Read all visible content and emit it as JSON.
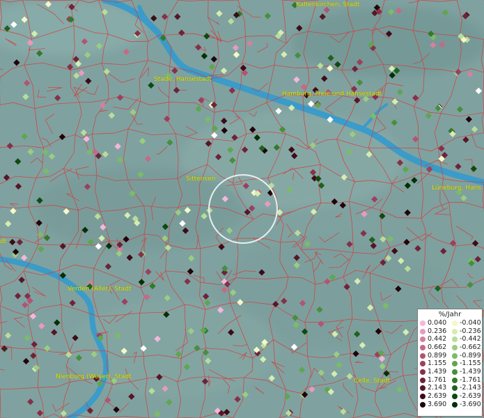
{
  "map": {
    "cities": [
      {
        "id": "kaltenkirchen",
        "label": "Kaltenkirchen, Stadt"
      },
      {
        "id": "stade",
        "label": "Stade, Hansestadt"
      },
      {
        "id": "hamburg",
        "label": "Hamburg, Freie und Hansestadt"
      },
      {
        "id": "sittensen",
        "label": "Sittensen"
      },
      {
        "id": "lueneburg",
        "label": "Lüneburg, Hans"
      },
      {
        "id": "verden",
        "label": "Verden (Aller), Stadt"
      },
      {
        "id": "nienburg",
        "label": "Nienburg (Weser), Stadt"
      },
      {
        "id": "celle",
        "label": "Celle, Stadt"
      },
      {
        "id": "edge-left",
        "label": "dt"
      }
    ],
    "colors": {
      "background": "#7fa2a0",
      "river": "#2f9ad0",
      "boundary": "#d63a3a",
      "label": "#e6e600"
    }
  },
  "legend": {
    "unit": "%/Jahr",
    "positive": [
      "0.040",
      "0.236",
      "0.442",
      "0.662",
      "0.899",
      "1.155",
      "1.439",
      "1.761",
      "2.143",
      "2.639",
      "3.690"
    ],
    "negative": [
      "-0.040",
      "-0.236",
      "-0.442",
      "-0.662",
      "-0.899",
      "-1.155",
      "-1.439",
      "-1.761",
      "-2.143",
      "-2.639",
      "-3.690"
    ],
    "positive_colors": [
      "#f5b6dc",
      "#e79ac2",
      "#d6809f",
      "#c56a86",
      "#b15573",
      "#9d3f5d",
      "#87304a",
      "#6f2238",
      "#571628",
      "#3e0b17",
      "#20040a"
    ],
    "negative_colors": [
      "#f4f8c8",
      "#d6ecb0",
      "#b9dd98",
      "#9acd80",
      "#7cbb68",
      "#5fa64f",
      "#46903c",
      "#317a2c",
      "#1f621e",
      "#0f4a11",
      "#053007"
    ]
  }
}
